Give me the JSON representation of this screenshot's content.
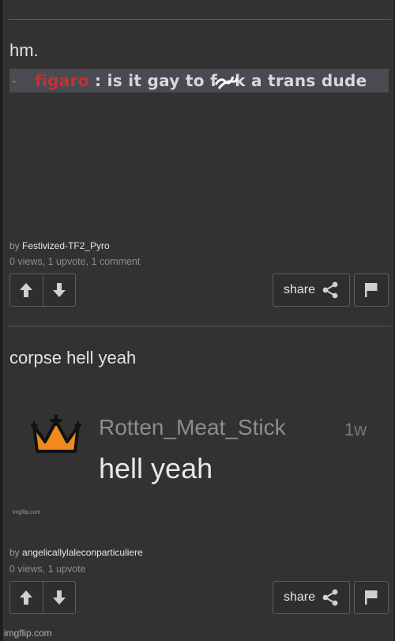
{
  "posts": [
    {
      "title": "hm.",
      "meme": {
        "speaker": "figaro",
        "separator": " : ",
        "message_before": " is it gay to f",
        "message_after": "k a trans dude",
        "small_mark": "↳"
      },
      "byline_prefix": "by ",
      "author": "Festivized-TF2_Pyro",
      "stats": "0 views, 1 upvote, 1 comment",
      "share_label": "share"
    },
    {
      "title": "corpse hell yeah",
      "meme": {
        "username": "Rotten_Meat_Stick",
        "time": "1w",
        "message": "hell yeah",
        "watermark": "imgflip.com"
      },
      "byline_prefix": "by ",
      "author": "angelicallylaleconparticuliere",
      "stats": "0 views, 1 upvote",
      "share_label": "share"
    }
  ],
  "footer": {
    "watermark": "imgflip.com"
  },
  "colors": {
    "background": "#323232",
    "crown": "#f08a1e",
    "speaker_name": "#c83030"
  },
  "icons": [
    "arrow-up-icon",
    "arrow-down-icon",
    "share-icon",
    "flag-icon",
    "crown-icon"
  ]
}
